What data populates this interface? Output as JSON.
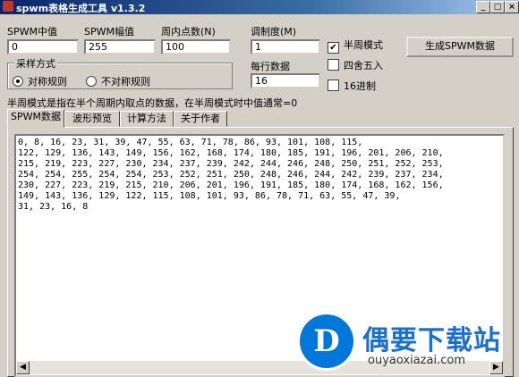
{
  "window": {
    "title": "spwm表格生成工具 v1.3.2",
    "min": "_",
    "max": "□",
    "close": "×"
  },
  "fields": {
    "spwm_mid_label": "SPWM中值",
    "spwm_mid_value": "0",
    "spwm_amp_label": "SPWM幅值",
    "spwm_amp_value": "255",
    "points_label": "周内点数(N)",
    "points_value": "100",
    "modulation_label": "调制度(M)",
    "modulation_value": "1",
    "per_line_label": "每行数据",
    "per_line_value": "16"
  },
  "options": {
    "half_cycle": "半周模式",
    "half_cycle_checked": true,
    "round": "四舍五入",
    "round_checked": false,
    "hex": "16进制",
    "hex_checked": false
  },
  "sampling": {
    "title": "采样方式",
    "symmetric": "对称规则",
    "asymmetric": "不对称规则",
    "selected": "symmetric"
  },
  "generate_button": "生成SPWM数据",
  "info_text": "半周模式是指在半个周期内取点的数据，在半周模式时中值通常=0",
  "tabs": [
    "SPWM数据",
    "波形预览",
    "计算方法",
    "关于作者"
  ],
  "active_tab": 0,
  "data_lines": [
    "0, 8, 16, 23, 31, 39, 47, 55, 63, 71, 78, 86, 93, 101, 108, 115,",
    "122, 129, 136, 143, 149, 156, 162, 168, 174, 180, 185, 191, 196, 201, 206, 210,",
    "215, 219, 223, 227, 230, 234, 237, 239, 242, 244, 246, 248, 250, 251, 252, 253,",
    "254, 254, 255, 254, 254, 253, 252, 251, 250, 248, 246, 244, 242, 239, 237, 234,",
    "230, 227, 223, 219, 215, 210, 206, 201, 196, 191, 185, 180, 174, 168, 162, 156,",
    "149, 143, 136, 129, 122, 115, 108, 101, 93, 86, 78, 71, 63, 55, 47, 39,",
    "31, 23, 16, 8"
  ],
  "watermark": {
    "title": "偶要下载站",
    "url": "ouyaoxiazai.com",
    "logo_glyph": "D"
  },
  "colors": {
    "titlebar_start": "#0a246a",
    "titlebar_end": "#a6caf0",
    "face": "#d4d0c8",
    "watermark_blue": "#1b6fd1"
  }
}
